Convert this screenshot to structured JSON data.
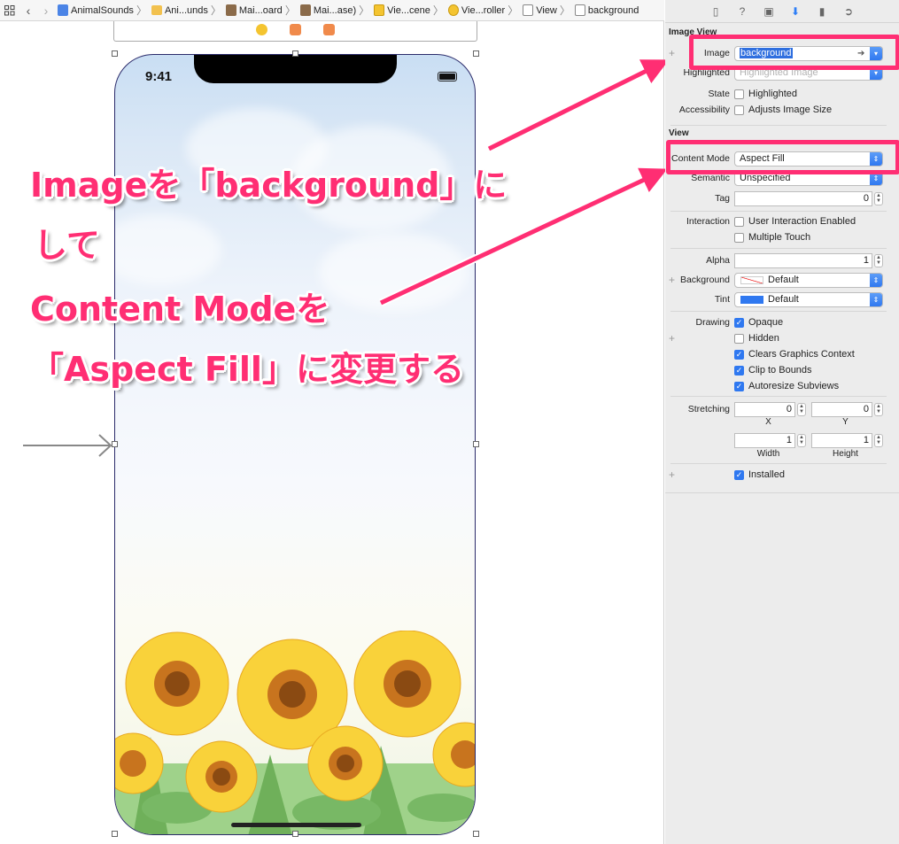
{
  "jumpbar": {
    "crumbs": [
      {
        "label": "AnimalSounds",
        "icon": "swift-project-icon"
      },
      {
        "label": "Ani...unds",
        "icon": "folder-icon"
      },
      {
        "label": "Mai...oard",
        "icon": "storyboard-icon"
      },
      {
        "label": "Mai...ase)",
        "icon": "storyboard-icon"
      },
      {
        "label": "Vie...cene",
        "icon": "scene-icon"
      },
      {
        "label": "Vie...roller",
        "icon": "view-controller-icon"
      },
      {
        "label": "View",
        "icon": "view-icon"
      },
      {
        "label": "background",
        "icon": "image-view-icon"
      }
    ]
  },
  "phone": {
    "time": "9:41"
  },
  "annotation": {
    "line1": "Imageを「background」に",
    "line2": "して",
    "line3": "Content Modeを",
    "line4": "「Aspect Fill」に変更する",
    "color": "#ff2e73"
  },
  "inspector": {
    "image_view_section": "Image View",
    "image_label": "Image",
    "image_value": "background",
    "highlighted_label": "Highlighted",
    "highlighted_placeholder": "Highlighted Image",
    "state_label": "State",
    "state_checkbox": "Highlighted",
    "accessibility_label": "Accessibility",
    "accessibility_checkbox": "Adjusts Image Size",
    "view_section": "View",
    "content_mode_label": "Content Mode",
    "content_mode_value": "Aspect Fill",
    "semantic_label": "Semantic",
    "semantic_value": "Unspecified",
    "tag_label": "Tag",
    "tag_value": "0",
    "interaction_label": "Interaction",
    "user_interaction": "User Interaction Enabled",
    "multiple_touch": "Multiple Touch",
    "alpha_label": "Alpha",
    "alpha_value": "1",
    "background_label": "Background",
    "background_value": "Default",
    "tint_label": "Tint",
    "tint_value": "Default",
    "tint_color": "#2f78f0",
    "drawing_label": "Drawing",
    "opaque": "Opaque",
    "hidden": "Hidden",
    "clears_graphics": "Clears Graphics Context",
    "clip_to_bounds": "Clip to Bounds",
    "autoresize": "Autoresize Subviews",
    "stretching_label": "Stretching",
    "stretch_x": "0",
    "stretch_y": "0",
    "stretch_width": "1",
    "stretch_height": "1",
    "x_caption": "X",
    "y_caption": "Y",
    "width_caption": "Width",
    "height_caption": "Height",
    "installed": "Installed",
    "highlight_color": "#ff2e73"
  }
}
